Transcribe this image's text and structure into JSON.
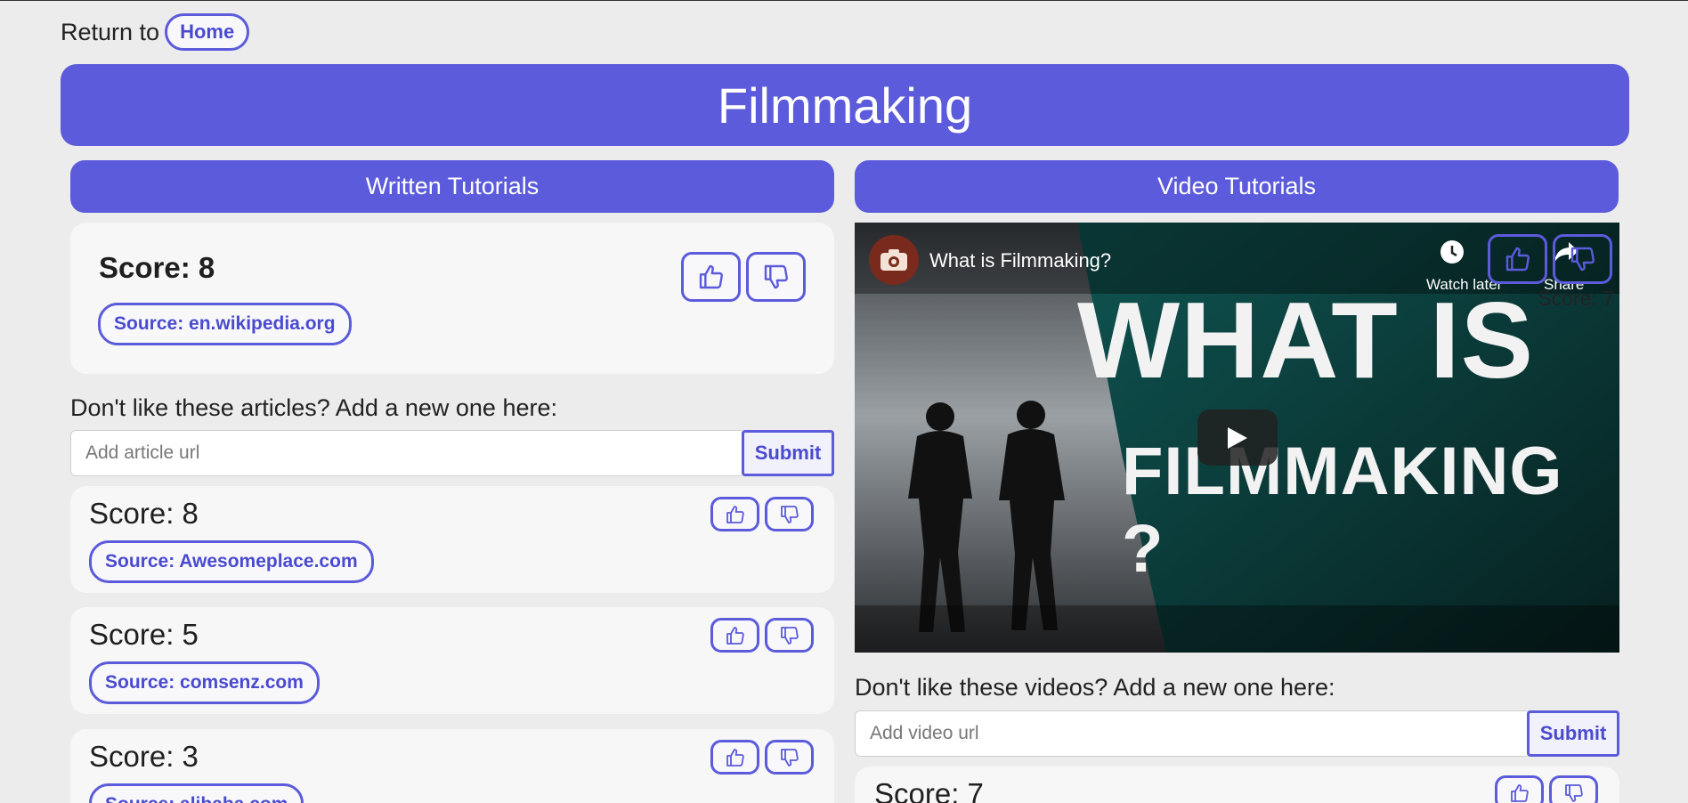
{
  "nav": {
    "return_text": "Return to",
    "home_label": "Home"
  },
  "page": {
    "title": "Filmmaking"
  },
  "written": {
    "header": "Written Tutorials",
    "featured": {
      "score": "Score: 8",
      "source": "Source: en.wikipedia.org"
    },
    "add": {
      "label": "Don't like these articles? Add a new one here:",
      "placeholder": "Add article url",
      "submit": "Submit"
    },
    "items": [
      {
        "score": "Score: 8",
        "source": "Source: Awesomeplace.com"
      },
      {
        "score": "Score: 5",
        "source": "Source: comsenz.com"
      },
      {
        "score": "Score: 3",
        "source": "Source: alibaba.com"
      }
    ]
  },
  "videos": {
    "header": "Video Tutorials",
    "player": {
      "title": "What is Filmmaking?",
      "watch_later": "Watch later",
      "share": "Share",
      "overlay_line1": "WHAT IS",
      "overlay_line2": "FILMMAKING ?",
      "score": "Score: 7"
    },
    "add": {
      "label": "Don't like these videos? Add a new one here:",
      "placeholder": "Add video url",
      "submit": "Submit"
    },
    "items": [
      {
        "score": "Score: 7"
      }
    ]
  },
  "icons": {
    "upvote": "thumbs-up-icon",
    "downvote": "thumbs-down-icon",
    "play": "play-icon",
    "clock": "clock-icon",
    "camera": "camera-icon",
    "share": "share-icon"
  },
  "colors": {
    "accent": "#5b5bdb",
    "background": "#ececec",
    "card": "#f7f7f7"
  }
}
